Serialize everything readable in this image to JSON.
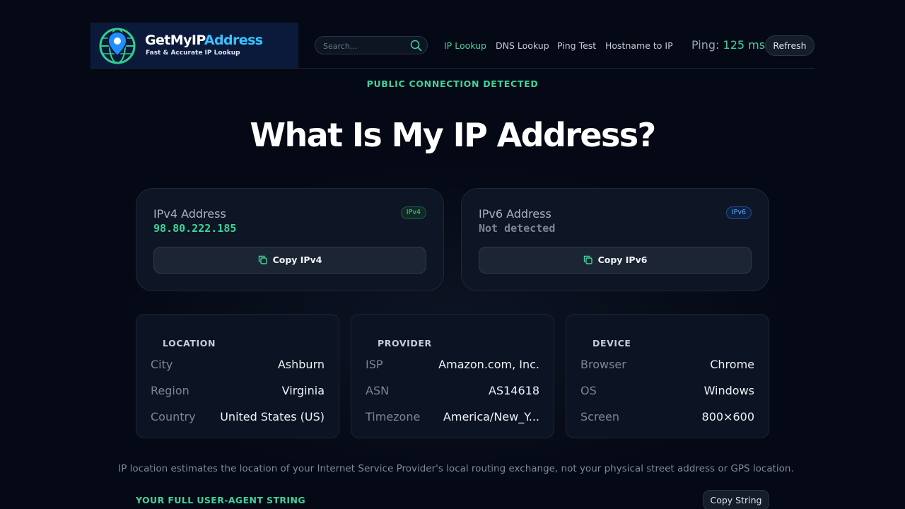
{
  "header": {
    "logo_title_main": "GetMyIP",
    "logo_title_accent": "Address",
    "logo_tagline": "Fast & Accurate IP Lookup",
    "search_placeholder": "Search...",
    "nav": [
      "IP Lookup",
      "DNS Lookup",
      "Ping Test",
      "Hostname to IP"
    ],
    "active_nav": "IP Lookup",
    "ping_label": "Ping:",
    "ping_value": "125 ms",
    "refresh_label": "Refresh"
  },
  "hero": {
    "status": "PUBLIC CONNECTION DETECTED",
    "title": "What Is My IP Address?"
  },
  "ipv4": {
    "label": "IPv4 Address",
    "badge": "IPv4",
    "value": "98.80.222.185",
    "copy_label": "Copy IPv4"
  },
  "ipv6": {
    "label": "IPv6 Address",
    "badge": "IPv6",
    "value": "Not detected",
    "copy_label": "Copy IPv6"
  },
  "location": {
    "heading": "LOCATION",
    "rows": [
      {
        "key": "City",
        "value": "Ashburn"
      },
      {
        "key": "Region",
        "value": "Virginia"
      },
      {
        "key": "Country",
        "value": "United States (US)"
      }
    ]
  },
  "provider": {
    "heading": "PROVIDER",
    "rows": [
      {
        "key": "ISP",
        "value": "Amazon.com, Inc."
      },
      {
        "key": "ASN",
        "value": "AS14618"
      },
      {
        "key": "Timezone",
        "value": "America/New_Y..."
      }
    ]
  },
  "device": {
    "heading": "DEVICE",
    "rows": [
      {
        "key": "Browser",
        "value": "Chrome"
      },
      {
        "key": "OS",
        "value": "Windows"
      },
      {
        "key": "Screen",
        "value": "800×600"
      }
    ]
  },
  "note": "IP location estimates the location of your Internet Service Provider's local routing exchange, not your physical street address or GPS location.",
  "user_agent": {
    "label": "YOUR FULL USER-AGENT STRING",
    "copy_label": "Copy String"
  },
  "colors": {
    "background": "#050915",
    "accent_green": "#3fd39a",
    "accent_blue": "#38c3ff",
    "card": "#0e1524"
  },
  "icons": [
    "globe-pin-logo-icon",
    "search-icon",
    "copy-icon"
  ]
}
